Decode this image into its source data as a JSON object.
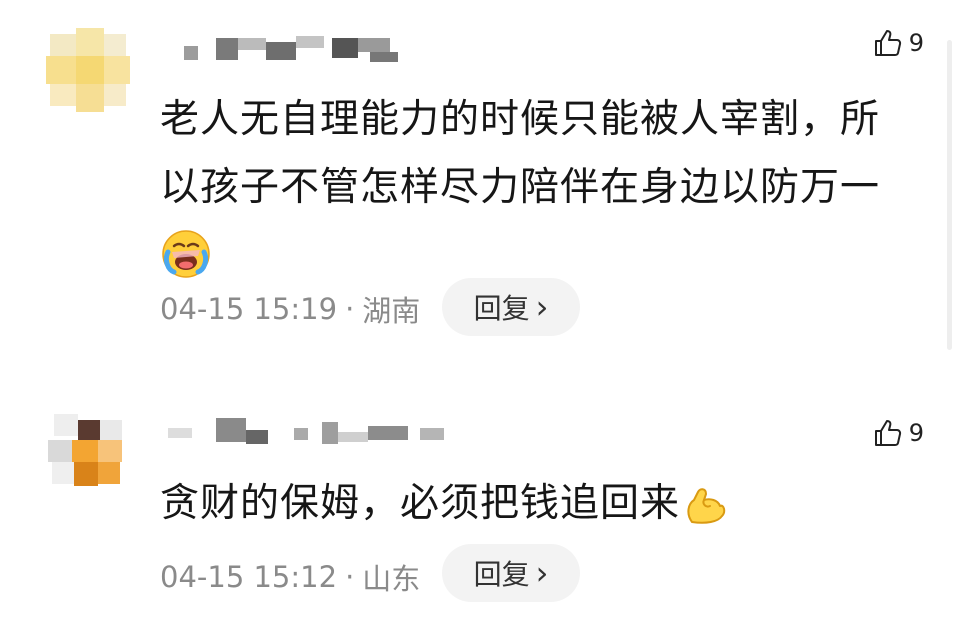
{
  "comments": [
    {
      "like_count": "9",
      "text_line1": "老人无自理能力的时候只能被人宰割，所",
      "text_line2": "以孩子不管怎样尽力陪伴在身边以防万一",
      "emoji": "crying-face-emoji",
      "timestamp": "04-15 15:19",
      "separator": "·",
      "location": "湖南",
      "reply_label": "回复",
      "reply_arrow": "›"
    },
    {
      "like_count": "9",
      "text_line1": "贪财的保姆，必须把钱追回来",
      "emoji": "flexed-biceps-emoji",
      "timestamp": "04-15 15:12",
      "separator": "·",
      "location": "山东",
      "reply_label": "回复",
      "reply_arrow": "›"
    }
  ],
  "colors": {
    "text": "#161616",
    "meta": "#8a8a8a",
    "reply_bg": "#f3f3f3"
  }
}
